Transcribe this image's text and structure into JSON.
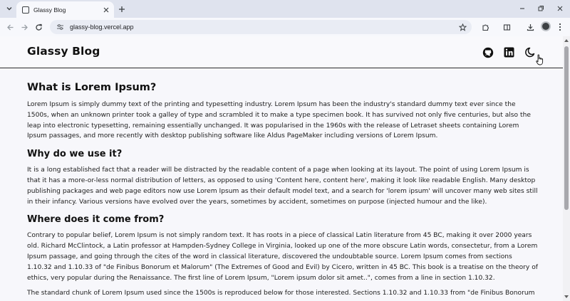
{
  "browser": {
    "tab_title": "Glassy Blog",
    "url": "glassy-blog.vercel.app"
  },
  "icons": {
    "tab_search": "chevron-down-icon",
    "favicon": "page-icon",
    "tab_close": "close-icon",
    "new_tab": "plus-icon",
    "minimize": "minimize-icon",
    "restore": "restore-icon",
    "close_window": "close-icon",
    "back": "back-arrow-icon",
    "forward": "forward-arrow-icon",
    "reload": "reload-icon",
    "site_info": "tune-icon",
    "bookmark": "star-icon",
    "extensions": "puzzle-icon",
    "side_panel": "side-panel-icon",
    "downloads": "download-icon",
    "profile": "avatar-icon",
    "menu": "kebab-menu-icon",
    "github": "github-icon",
    "linkedin": "linkedin-icon",
    "theme_toggle": "moon-icon"
  },
  "site": {
    "brand": "Glassy Blog"
  },
  "article": {
    "sections": [
      {
        "heading": "What is Lorem Ipsum?",
        "body": "Lorem Ipsum is simply dummy text of the printing and typesetting industry. Lorem Ipsum has been the industry's standard dummy text ever since the 1500s, when an unknown printer took a galley of type and scrambled it to make a type specimen book. It has survived not only five centuries, but also the leap into electronic typesetting, remaining essentially unchanged. It was popularised in the 1960s with the release of Letraset sheets containing Lorem Ipsum passages, and more recently with desktop publishing software like Aldus PageMaker including versions of Lorem Ipsum."
      },
      {
        "heading": "Why do we use it?",
        "body": "It is a long established fact that a reader will be distracted by the readable content of a page when looking at its layout. The point of using Lorem Ipsum is that it has a more-or-less normal distribution of letters, as opposed to using 'Content here, content here', making it look like readable English. Many desktop publishing packages and web page editors now use Lorem Ipsum as their default model text, and a search for 'lorem ipsum' will uncover many web sites still in their infancy. Various versions have evolved over the years, sometimes by accident, sometimes on purpose (injected humour and the like)."
      },
      {
        "heading": "Where does it come from?",
        "body": "Contrary to popular belief, Lorem Ipsum is not simply random text. It has roots in a piece of classical Latin literature from 45 BC, making it over 2000 years old. Richard McClintock, a Latin professor at Hampden-Sydney College in Virginia, looked up one of the more obscure Latin words, consectetur, from a Lorem Ipsum passage, and going through the cites of the word in classical literature, discovered the undoubtable source. Lorem Ipsum comes from sections 1.10.32 and 1.10.33 of \"de Finibus Bonorum et Malorum\" (The Extremes of Good and Evil) by Cicero, written in 45 BC. This book is a treatise on the theory of ethics, very popular during the Renaissance. The first line of Lorem Ipsum, \"Lorem ipsum dolor sit amet..\", comes from a line in section 1.10.32.",
        "continuation": "The standard chunk of Lorem Ipsum used since the 1500s is reproduced below for those interested. Sections 1.10.32 and 1.10.33 from \"de Finibus Bonorum"
      }
    ]
  },
  "colors": {
    "tabstrip": "#dfe3ee",
    "toolbar": "#f7f8fc",
    "page_background": "#f7f7fb",
    "text": "#1c1c1c",
    "heading": "#111111"
  }
}
